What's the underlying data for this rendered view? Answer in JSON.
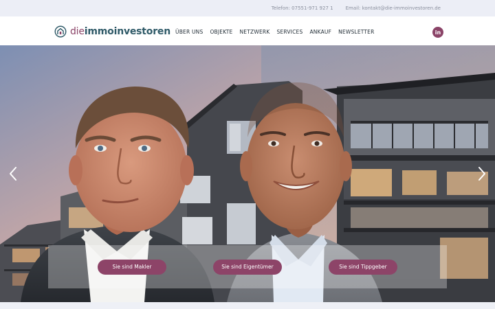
{
  "topbar": {
    "phone": "Telefon:  07551-971 927 1",
    "email": "Email:  kontakt@die-immoinvestoren.de"
  },
  "logo": {
    "text_part1": "die",
    "text_part2": "immoinvestoren",
    "brand_color": "#8b4468",
    "accent_color": "#2f5a68"
  },
  "nav": {
    "items": [
      {
        "label": "ÜBER UNS"
      },
      {
        "label": "OBJEKTE"
      },
      {
        "label": "NETZWERK"
      },
      {
        "label": "SERVICES"
      },
      {
        "label": "ANKAUF"
      },
      {
        "label": "NEWSLETTER"
      }
    ]
  },
  "social": {
    "linkedin_label": "in",
    "icon": "linkedin-icon"
  },
  "hero": {
    "prev_icon": "chevron-left-icon",
    "next_icon": "chevron-right-icon",
    "ctas": [
      {
        "label": "Sie sind Makler"
      },
      {
        "label": "Sie sind Eigentümer"
      },
      {
        "label": "Sie sind Tippgeber"
      }
    ],
    "button_color": "#8d4468"
  }
}
